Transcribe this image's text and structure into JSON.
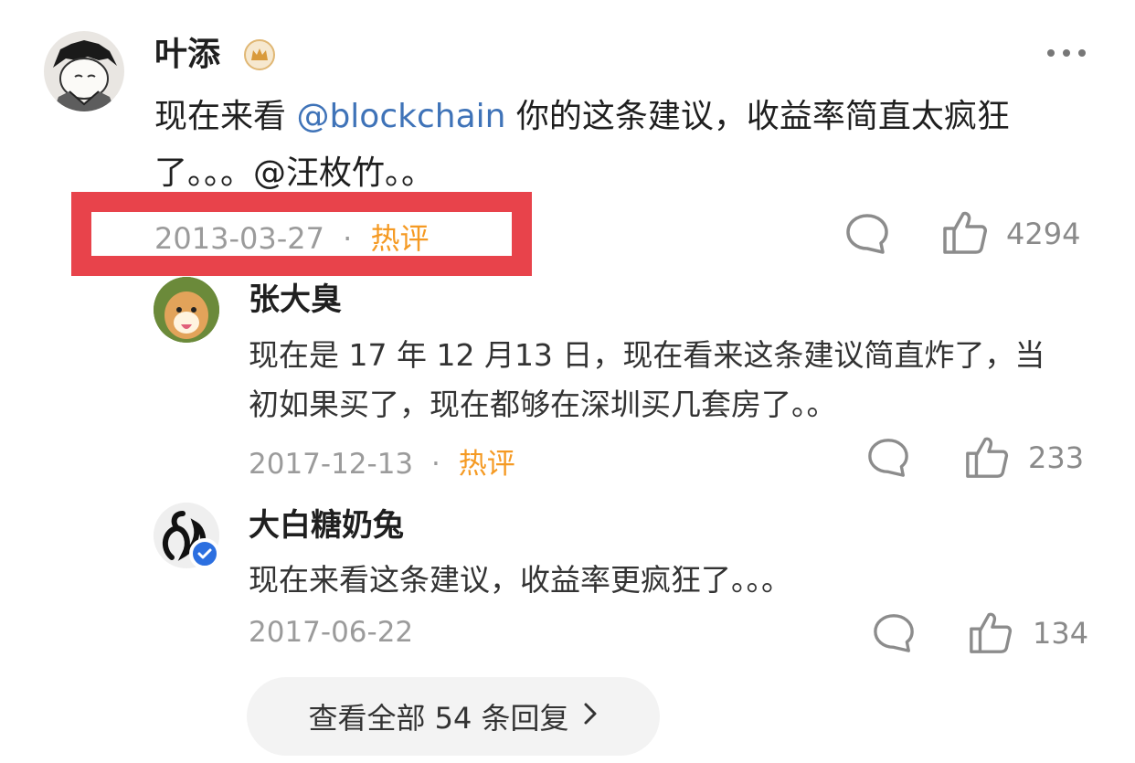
{
  "main_comment": {
    "author": "叶添",
    "text_before": "现在来看 ",
    "mention": "@blockchain",
    "text_after": " 你的这条建议，收益率简直太疯狂了。。。@汪枚竹。。",
    "date": "2013-03-27",
    "separator": "·",
    "tag": "热评",
    "likes": "4294",
    "icons": {
      "crown": "crown-icon",
      "more": "more-icon",
      "comment": "comment-icon",
      "like": "like-icon"
    }
  },
  "replies": [
    {
      "author": "张大臭",
      "text": "现在是 17 年 12 月13 日，现在看来这条建议简直炸了，当初如果买了，现在都够在深圳买几套房了。。",
      "date": "2017-12-13",
      "separator": "·",
      "tag": "热评",
      "likes": "233"
    },
    {
      "author": "大白糖奶兔",
      "text": "现在来看这条建议，收益率更疯狂了。。。",
      "date": "2017-06-22",
      "likes": "134",
      "verified": true
    }
  ],
  "view_all": {
    "label": "查看全部 54 条回复"
  },
  "colors": {
    "accent_hot": "#f59a23",
    "mention": "#3f73b8",
    "highlight": "#e8434b",
    "verified": "#2c6fe0"
  }
}
